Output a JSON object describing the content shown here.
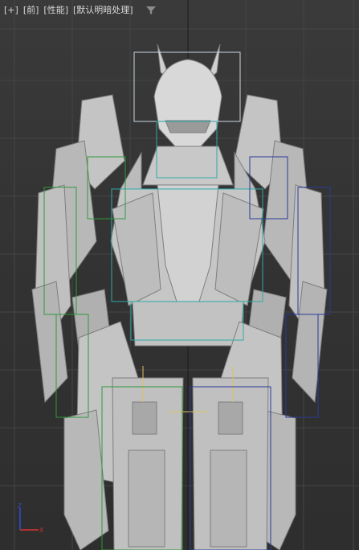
{
  "viewport": {
    "labels": {
      "plus": "[+]",
      "view": "[前]",
      "shading": "[性能]",
      "lighting": "[默认明暗处理]"
    },
    "filter_icon": "filter-icon",
    "axis_gizmo": {
      "z": "Z",
      "x": "X"
    },
    "colors": {
      "background": "#333333",
      "grid": "#4a4a4a",
      "model": "#bdbdbd",
      "bbox_head": "#c9d6e0",
      "bbox_torso": "#2fa8a8",
      "bbox_left": "#2e9a3a",
      "bbox_right": "#2a3a9a",
      "axis_z": "#2a4fd8",
      "axis_x": "#d83030",
      "bone_highlight": "#e0c060"
    }
  }
}
